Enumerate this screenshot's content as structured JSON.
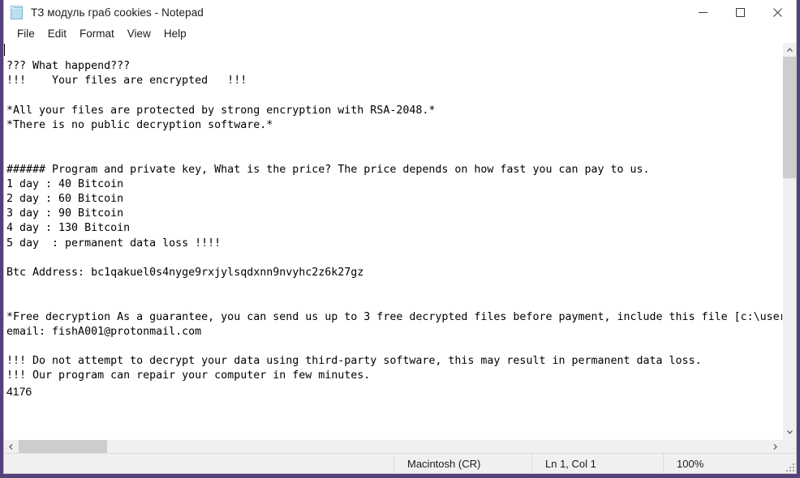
{
  "window": {
    "title": "ТЗ модуль граб cookies - Notepad",
    "icon": "notepad-icon",
    "controls": {
      "minimize": "minimize-icon",
      "maximize": "maximize-icon",
      "close": "close-icon"
    }
  },
  "menu": [
    {
      "label": "File"
    },
    {
      "label": "Edit"
    },
    {
      "label": "Format"
    },
    {
      "label": "View"
    },
    {
      "label": "Help"
    }
  ],
  "document": {
    "body": "\n??? What happend???\n!!!    Your files are encrypted   !!!\n\n*All your files are protected by strong encryption with RSA-2048.*\n*There is no public decryption software.*\n\n\n###### Program and private key, What is the price? The price depends on how fast you can pay to us.\n1 day : 40 Bitcoin\n2 day : 60 Bitcoin\n3 day : 90 Bitcoin\n4 day : 130 Bitcoin\n5 day  : permanent data loss !!!!\n\nBtc Address: bc1qakuel0s4nyge9rxjylsqdxnn9nvyhc2z6k27gz\n\n\n*Free decryption As a guarantee, you can send us up to 3 free decrypted files before payment, include this file [c:\\user\nemail: fishA001@protonmail.com\n\n!!! Do not attempt to decrypt your data using third-party software, this may result in permanent data loss.\n!!! Our program can repair your computer in few minutes.\n",
    "trailing_number": "4176"
  },
  "statusbar": {
    "encoding": "Macintosh (CR)",
    "position": "Ln 1, Col 1",
    "zoom": "100%"
  },
  "colors": {
    "desktop": "#54407a",
    "window_bg": "#ffffff",
    "statusbar_bg": "#f0f0f0",
    "scrollbar_thumb": "#cdcdcd"
  }
}
